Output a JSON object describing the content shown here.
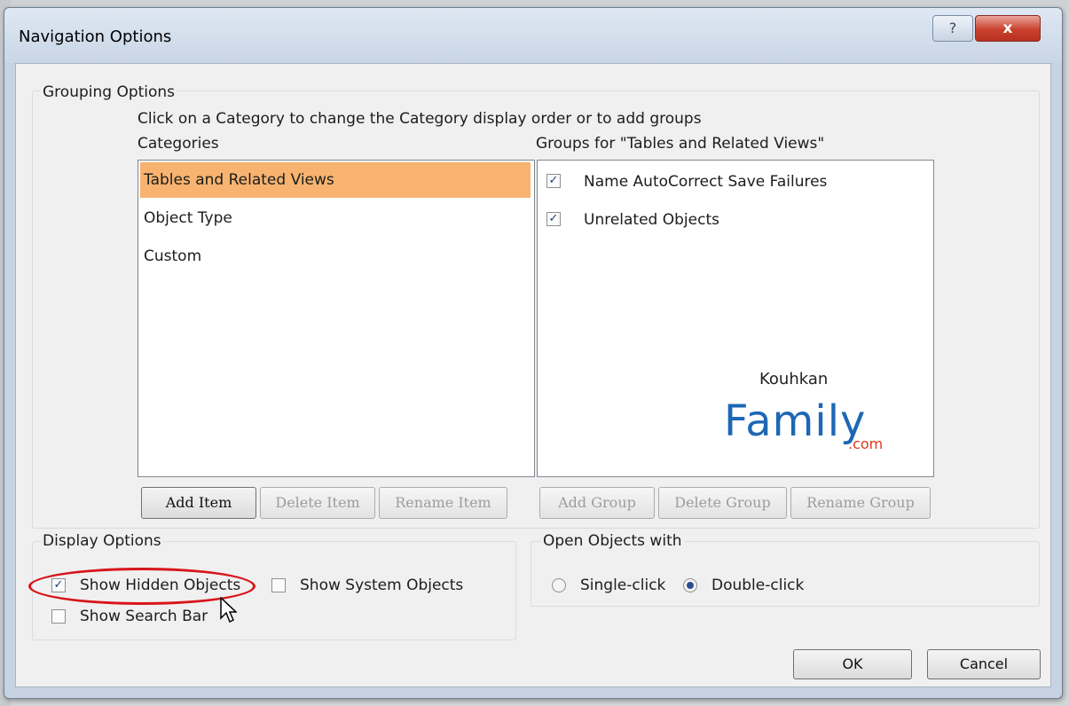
{
  "window": {
    "title": "Navigation Options",
    "help_glyph": "?",
    "close_glyph": "x"
  },
  "grouping": {
    "legend": "Grouping Options",
    "instruction": "Click on a Category to change the Category display order or to add groups",
    "categories_label": "Categories",
    "categories": [
      {
        "label": "Tables and Related Views",
        "selected": true
      },
      {
        "label": "Object Type",
        "selected": false
      },
      {
        "label": "Custom",
        "selected": false
      }
    ],
    "groups_label": "Groups for \"Tables and Related Views\"",
    "groups": [
      {
        "label": "Name AutoCorrect Save Failures",
        "checked": true
      },
      {
        "label": "Unrelated Objects",
        "checked": true
      }
    ],
    "buttons": {
      "add_item": "Add Item",
      "delete_item": "Delete Item",
      "rename_item": "Rename Item",
      "add_group": "Add Group",
      "delete_group": "Delete Group",
      "rename_group": "Rename Group"
    }
  },
  "display_options": {
    "legend": "Display Options",
    "show_hidden_objects": {
      "label": "Show Hidden Objects",
      "checked": true
    },
    "show_system_objects": {
      "label": "Show System Objects",
      "checked": false
    },
    "show_search_bar": {
      "label": "Show Search Bar",
      "checked": false
    }
  },
  "open_objects": {
    "legend": "Open Objects with",
    "single_click": {
      "label": "Single-click",
      "selected": false
    },
    "double_click": {
      "label": "Double-click",
      "selected": true
    }
  },
  "footer": {
    "ok": "OK",
    "cancel": "Cancel"
  },
  "watermark": {
    "top": "Kouhkan",
    "main": "Family",
    "suffix": ".com"
  },
  "colors": {
    "selected_row": "#f7b36f",
    "annotation_circle": "#d7151b",
    "close_button": "#c9412f"
  },
  "checkmark_glyph": "✓"
}
